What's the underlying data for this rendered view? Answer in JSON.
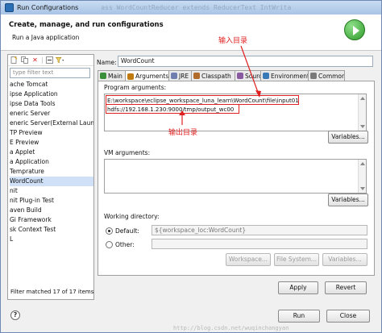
{
  "window": {
    "title": "Run Configurations",
    "background_code": "ass WordCountReducer extends ReducerText IntWrita"
  },
  "header": {
    "title": "Create, manage, and run configurations",
    "subtitle": "Run a Java application",
    "icon": "run-icon"
  },
  "sidebar": {
    "toolbar_icons": [
      "new-icon",
      "duplicate-icon",
      "delete-icon",
      "collapse-icon",
      "filter-icon"
    ],
    "filter_placeholder": "type filter text",
    "items": [
      {
        "label": "ache Tomcat",
        "selected": false
      },
      {
        "label": "ipse Application",
        "selected": false
      },
      {
        "label": "ipse Data Tools",
        "selected": false
      },
      {
        "label": "eneric Server",
        "selected": false
      },
      {
        "label": "eneric Server(External Launch)",
        "selected": false
      },
      {
        "label": "TP Preview",
        "selected": false
      },
      {
        "label": "E Preview",
        "selected": false
      },
      {
        "label": "a Applet",
        "selected": false
      },
      {
        "label": "a Application",
        "selected": false
      },
      {
        "label": "Temprature",
        "selected": false
      },
      {
        "label": "WordCount",
        "selected": true
      },
      {
        "label": "nit",
        "selected": false
      },
      {
        "label": "nit Plug-in Test",
        "selected": false
      },
      {
        "label": "aven Build",
        "selected": false
      },
      {
        "label": "Gi Framework",
        "selected": false
      },
      {
        "label": "sk Context Test",
        "selected": false
      },
      {
        "label": "L",
        "selected": false
      }
    ],
    "status": "Filter matched 17 of 17 items"
  },
  "config": {
    "name_label": "Name:",
    "name_value": "WordCount",
    "tabs": [
      {
        "label": "Main",
        "icon": "main-tab-icon",
        "active": false
      },
      {
        "label": "Arguments",
        "icon": "arguments-tab-icon",
        "active": true
      },
      {
        "label": "JRE",
        "icon": "jre-tab-icon",
        "active": false
      },
      {
        "label": "Classpath",
        "icon": "classpath-tab-icon",
        "active": false
      },
      {
        "label": "Source",
        "icon": "source-tab-icon",
        "active": false
      },
      {
        "label": "Environment",
        "icon": "environment-tab-icon",
        "active": false
      },
      {
        "label": "Common",
        "icon": "common-tab-icon",
        "active": false
      }
    ],
    "program_args_label": "Program arguments:",
    "program_args_lines": [
      "E:\\workspace\\eclipse_workspace_luna_learn\\WordCount\\file\\input01",
      "hdfs://192.168.1.230:9000/tmp/output_wc00"
    ],
    "variables_label": "Variables...",
    "vm_args_label": "VM arguments:",
    "vm_args_value": "",
    "working_dir_label": "Working directory:",
    "default_label": "Default:",
    "default_value": "${workspace_loc:WordCount}",
    "other_label": "Other:",
    "other_value": "",
    "workspace_btn": "Workspace...",
    "filesystem_btn": "File System...",
    "variables2_btn": "Variables..."
  },
  "annotations": {
    "input_dir": "输入目录",
    "output_dir": "输出目录",
    "color": "#e02020"
  },
  "buttons": {
    "apply": "Apply",
    "revert": "Revert",
    "run": "Run",
    "close": "Close"
  },
  "watermark": "http://blog.csdn.net/wuqinchangyan"
}
